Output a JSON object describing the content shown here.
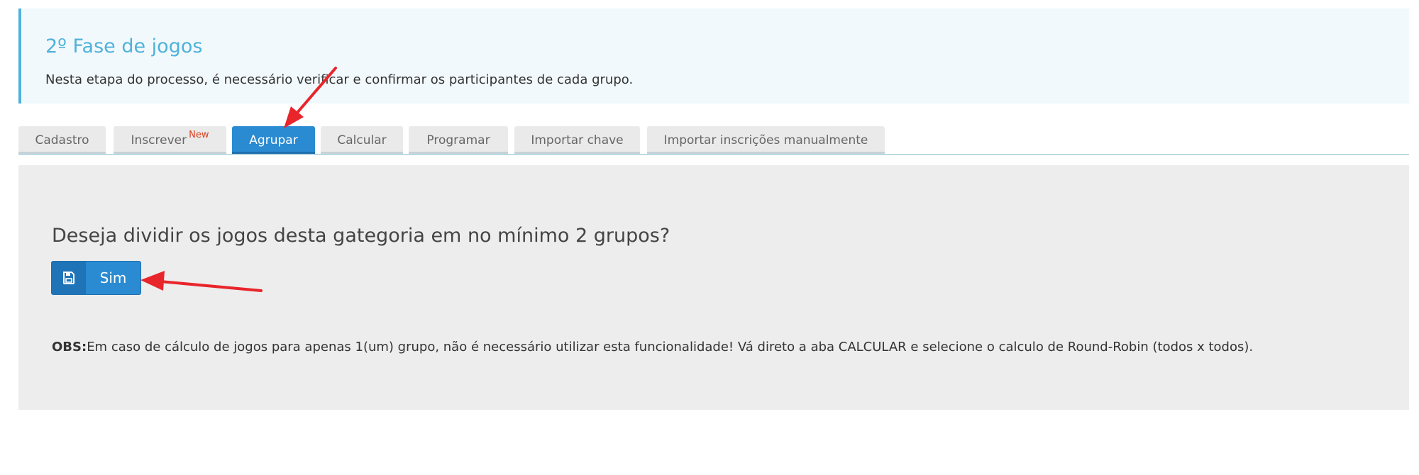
{
  "callout": {
    "title": "2º Fase de jogos",
    "text": "Nesta etapa do processo, é necessário verificar e confirmar os participantes de cada grupo."
  },
  "tabs": [
    {
      "label": "Cadastro",
      "active": false
    },
    {
      "label": "Inscrever",
      "badge": "New",
      "active": false
    },
    {
      "label": "Agrupar",
      "active": true
    },
    {
      "label": "Calcular",
      "active": false
    },
    {
      "label": "Programar",
      "active": false
    },
    {
      "label": "Importar chave",
      "active": false
    },
    {
      "label": "Importar inscrições manualmente",
      "active": false
    }
  ],
  "panel": {
    "question": "Deseja dividir os jogos desta gategoria em no mínimo 2 grupos?",
    "button": {
      "label": "Sim",
      "icon": "floppy-disk-icon"
    },
    "obs_label": "OBS:",
    "obs_text": "Em caso de cálculo de jogos para apenas 1(um) grupo, não é necessário utilizar esta funcionalidade! Vá direto a aba CALCULAR e selecione o calculo de Round-Robin (todos x todos)."
  },
  "colors": {
    "accent": "#2a8bd2",
    "callout_title": "#4fb2da",
    "callout_bg": "#f2f9fc",
    "panel_bg": "#ededed",
    "annotation_arrow": "#e8252b",
    "new_badge": "#d9411e"
  }
}
